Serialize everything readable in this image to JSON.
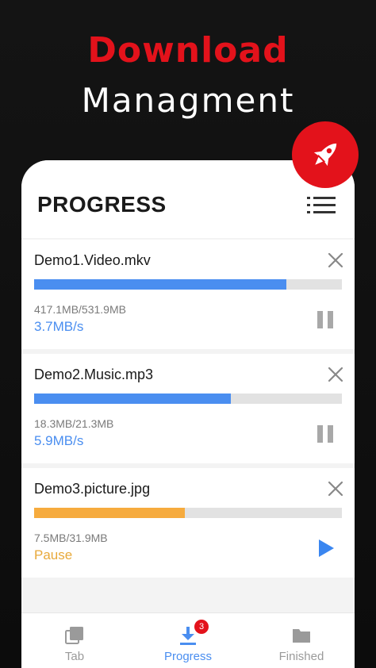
{
  "headline": {
    "line1": "Download",
    "line2": "Managment"
  },
  "header": {
    "title": "PROGRESS",
    "menu_icon": "list-menu-icon"
  },
  "badge": {
    "icon": "rocket-icon",
    "color": "#e3121b"
  },
  "downloads": [
    {
      "name": "Demo1.Video.mkv",
      "size": "417.1MB/531.9MB",
      "status": "3.7MB/s",
      "progress": 0.82,
      "state": "downloading",
      "bar_color": "#4a8ef0",
      "status_color": "#4a8ef0",
      "action_icon": "pause-icon"
    },
    {
      "name": "Demo2.Music.mp3",
      "size": "18.3MB/21.3MB",
      "status": "5.9MB/s",
      "progress": 0.64,
      "state": "downloading",
      "bar_color": "#4a8ef0",
      "status_color": "#4a8ef0",
      "action_icon": "pause-icon"
    },
    {
      "name": "Demo3.picture.jpg",
      "size": "7.5MB/31.9MB",
      "status": "Pause",
      "progress": 0.49,
      "state": "paused",
      "bar_color": "#f6ab3e",
      "status_color": "#e8a93a",
      "action_icon": "play-icon"
    }
  ],
  "nav": {
    "items": [
      {
        "label": "Tab",
        "icon": "tabs-icon",
        "active": false
      },
      {
        "label": "Progress",
        "icon": "download-icon",
        "active": true,
        "badge": "3"
      },
      {
        "label": "Finished",
        "icon": "folder-icon",
        "active": false
      }
    ],
    "active_color": "#4a8ef0",
    "inactive_color": "#9a9a9a"
  }
}
